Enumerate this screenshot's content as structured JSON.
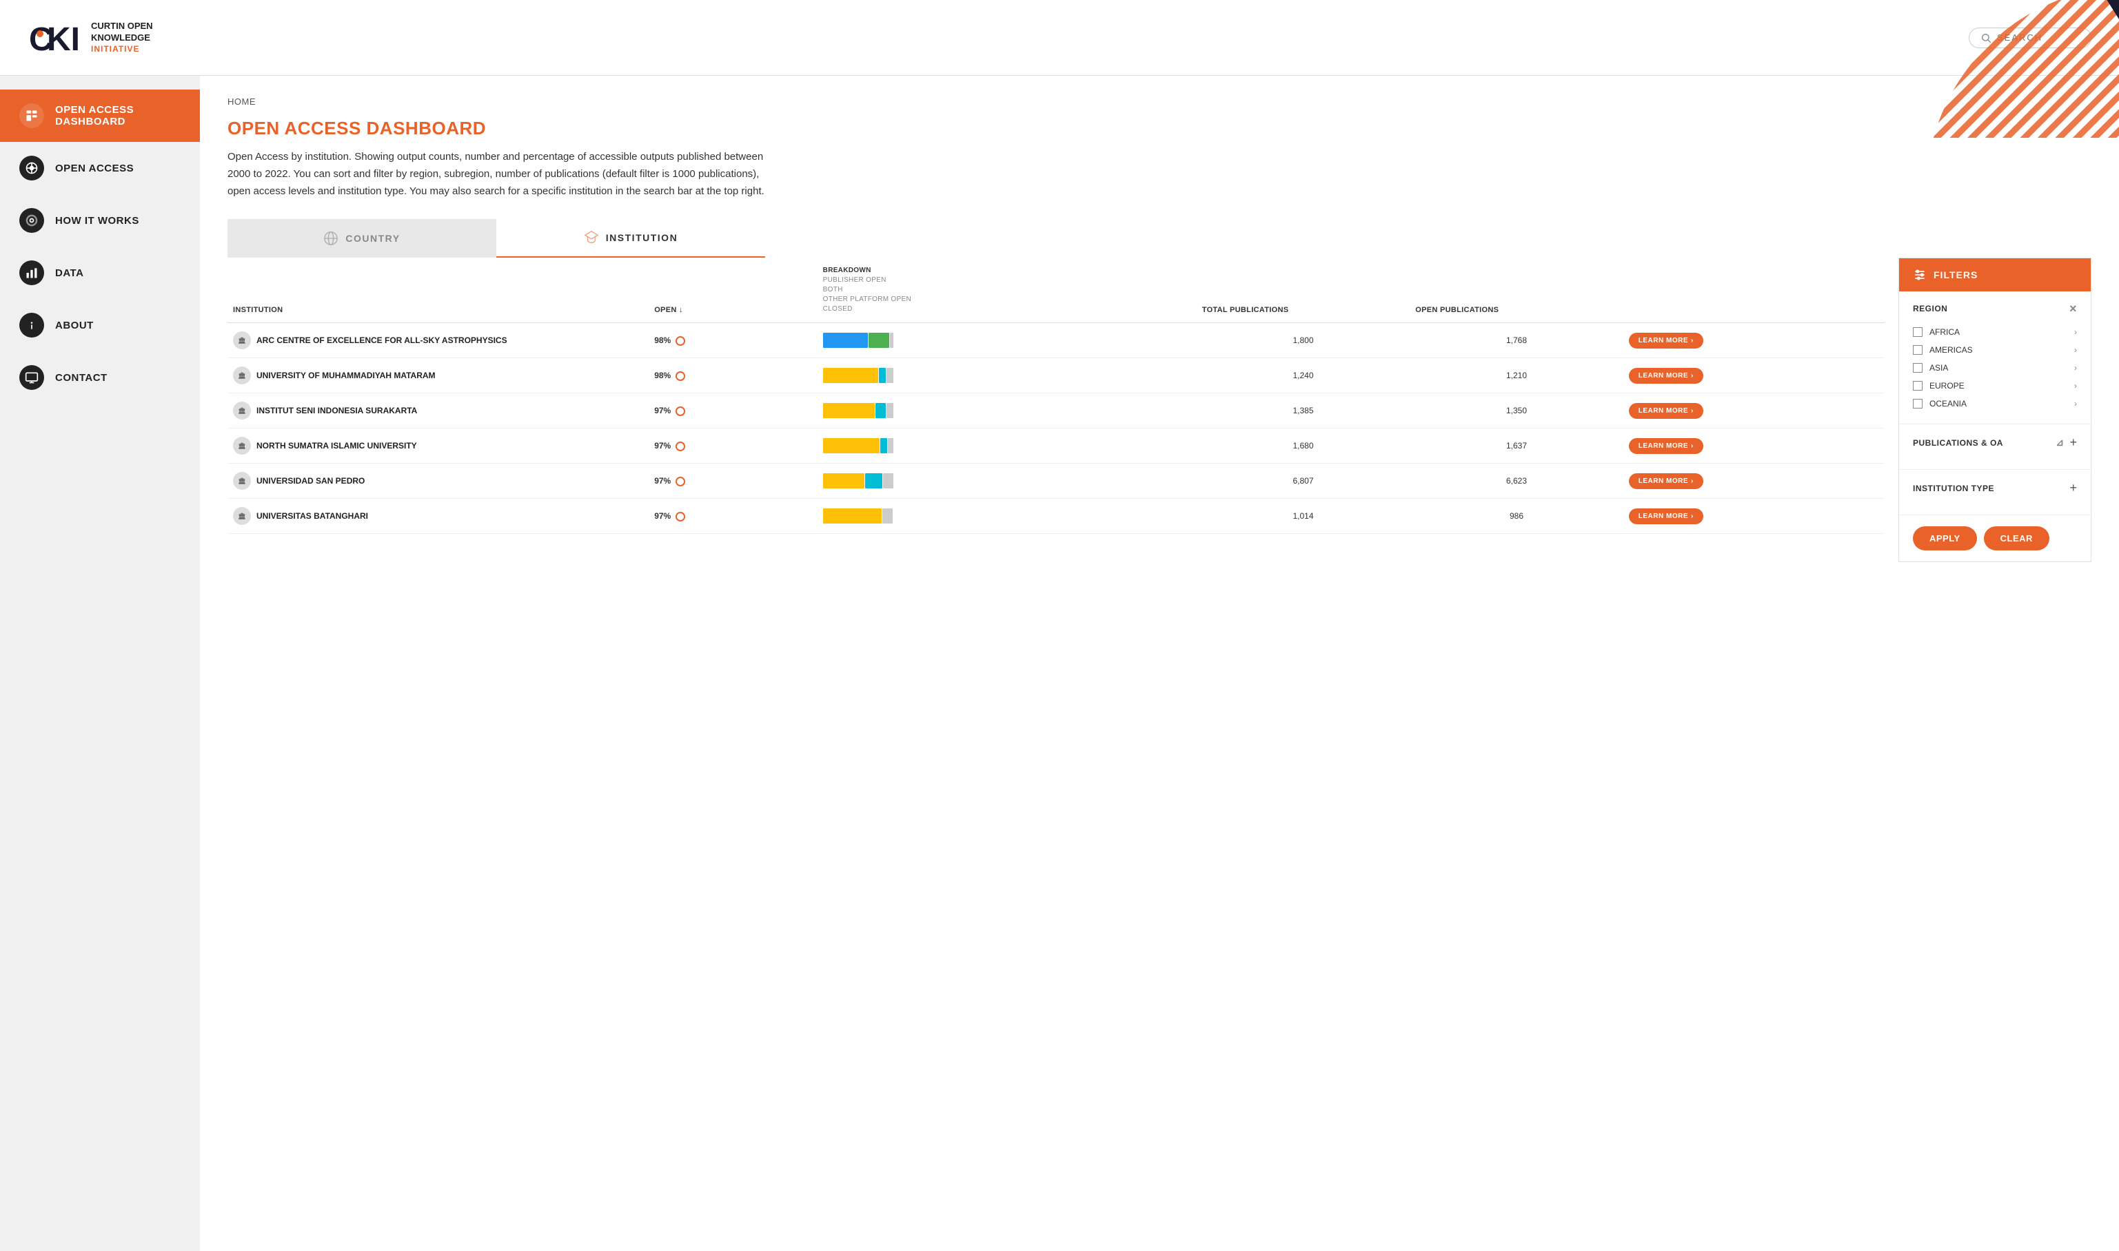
{
  "header": {
    "logo_main": "COKI",
    "logo_subtitle1": "CURTIN OPEN",
    "logo_subtitle2": "KNOWLEDGE",
    "logo_subtitle3": "INITIATIVE",
    "search_placeholder": "SEARCH"
  },
  "sidebar": {
    "items": [
      {
        "id": "open-access-dashboard",
        "label": "OPEN ACCESS DASHBOARD",
        "icon": "dashboard",
        "active": true
      },
      {
        "id": "open-access",
        "label": "OPEN ACCESS",
        "icon": "open-access",
        "active": false
      },
      {
        "id": "how-it-works",
        "label": "HOW IT WORKS",
        "icon": "gear",
        "active": false
      },
      {
        "id": "data",
        "label": "DATA",
        "icon": "bar-chart",
        "active": false
      },
      {
        "id": "about",
        "label": "ABOUT",
        "icon": "info",
        "active": false
      },
      {
        "id": "contact",
        "label": "CONTACT",
        "icon": "monitor",
        "active": false
      }
    ]
  },
  "breadcrumb": "HOME",
  "page": {
    "title": "OPEN ACCESS DASHBOARD",
    "description": "Open Access by institution. Showing output counts, number and percentage of accessible outputs published between 2000 to 2022. You can sort and filter by region, subregion, number of publications (default filter is 1000 publications), open access levels and institution type. You may also search for a specific institution in the search bar at the top right."
  },
  "tabs": [
    {
      "id": "country",
      "label": "COUNTRY",
      "active": false
    },
    {
      "id": "institution",
      "label": "INSTITUTION",
      "active": true
    }
  ],
  "table": {
    "columns": [
      {
        "id": "institution",
        "label": "INSTITUTION"
      },
      {
        "id": "open",
        "label": "OPEN ↓"
      },
      {
        "id": "breakdown",
        "label": "BREAKDOWN",
        "sub": [
          "PUBLISHER OPEN",
          "BOTH",
          "OTHER PLATFORM OPEN",
          "CLOSED"
        ]
      },
      {
        "id": "total",
        "label": "TOTAL PUBLICATIONS"
      },
      {
        "id": "open_pub",
        "label": "OPEN PUBLICATIONS"
      },
      {
        "id": "action",
        "label": ""
      }
    ],
    "rows": [
      {
        "name": "ARC CENTRE OF EXCELLENCE FOR ALL-SKY ASTROPHYSICS",
        "open_pct": "98%",
        "bars": [
          {
            "color": "blue",
            "width": 65
          },
          {
            "color": "green",
            "width": 30
          },
          {
            "color": "gray",
            "width": 5
          }
        ],
        "total": "1,800",
        "open_pub": "1,768",
        "learn_more": "LEARN MORE"
      },
      {
        "name": "UNIVERSITY OF MUHAMMADIYAH MATARAM",
        "open_pct": "98%",
        "bars": [
          {
            "color": "yellow",
            "width": 80
          },
          {
            "color": "teal",
            "width": 10
          },
          {
            "color": "gray",
            "width": 10
          }
        ],
        "total": "1,240",
        "open_pub": "1,210",
        "learn_more": "LEARN MORE"
      },
      {
        "name": "INSTITUT SENI INDONESIA SURAKARTA",
        "open_pct": "97%",
        "bars": [
          {
            "color": "yellow",
            "width": 75
          },
          {
            "color": "teal",
            "width": 15
          },
          {
            "color": "gray",
            "width": 10
          }
        ],
        "total": "1,385",
        "open_pub": "1,350",
        "learn_more": "LEARN MORE"
      },
      {
        "name": "NORTH SUMATRA ISLAMIC UNIVERSITY",
        "open_pct": "97%",
        "bars": [
          {
            "color": "yellow",
            "width": 82
          },
          {
            "color": "teal",
            "width": 10
          },
          {
            "color": "gray",
            "width": 8
          }
        ],
        "total": "1,680",
        "open_pub": "1,637",
        "learn_more": "LEARN MORE"
      },
      {
        "name": "UNIVERSIDAD SAN PEDRO",
        "open_pct": "97%",
        "bars": [
          {
            "color": "yellow",
            "width": 60
          },
          {
            "color": "teal",
            "width": 25
          },
          {
            "color": "gray",
            "width": 15
          }
        ],
        "total": "6,807",
        "open_pub": "6,623",
        "learn_more": "LEARN MORE"
      },
      {
        "name": "UNIVERSITAS BATANGHARI",
        "open_pct": "97%",
        "bars": [
          {
            "color": "yellow",
            "width": 85
          },
          {
            "color": "gray",
            "width": 15
          }
        ],
        "total": "1,014",
        "open_pub": "986",
        "learn_more": "LEARN MORE"
      }
    ]
  },
  "filters": {
    "title": "FILTERS",
    "region": {
      "label": "REGION",
      "items": [
        {
          "id": "africa",
          "label": "AFRICA",
          "has_sub": true
        },
        {
          "id": "americas",
          "label": "AMERICAS",
          "has_sub": true
        },
        {
          "id": "asia",
          "label": "ASIA",
          "has_sub": true
        },
        {
          "id": "europe",
          "label": "EUROPE",
          "has_sub": true
        },
        {
          "id": "oceania",
          "label": "OCEANIA",
          "has_sub": true
        }
      ]
    },
    "publications_oa": {
      "label": "PUBLICATIONS & OA"
    },
    "institution_type": {
      "label": "INSTITUTION TYPE"
    },
    "apply_label": "APPLY",
    "clear_label": "CLEAR"
  }
}
